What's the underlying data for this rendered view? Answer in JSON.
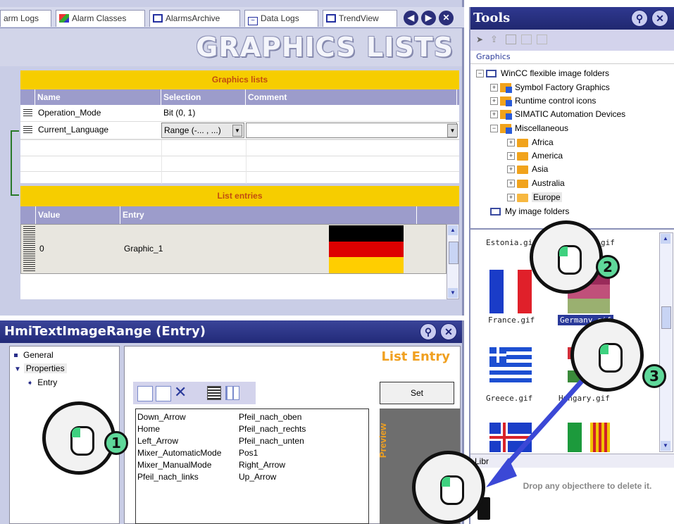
{
  "editor": {
    "tabs": [
      {
        "label": "arm Logs"
      },
      {
        "label": "Alarm Classes"
      },
      {
        "label": "AlarmsArchive"
      },
      {
        "label": "Data Logs"
      },
      {
        "label": "TrendView"
      }
    ],
    "banner_title": "GRAPHICS LISTS",
    "graphics_lists": {
      "section_title": "Graphics lists",
      "columns": [
        "Name",
        "Selection",
        "Comment"
      ],
      "rows": [
        {
          "name": "Operation_Mode",
          "selection": "Bit (0, 1)",
          "comment": ""
        },
        {
          "name": "Current_Language",
          "selection": "Range (-... , ...)",
          "comment": ""
        }
      ]
    },
    "list_entries": {
      "section_title": "List entries",
      "columns": [
        "Value",
        "Entry"
      ],
      "rows": [
        {
          "value": "0",
          "entry": "Graphic_1",
          "flag_colors": [
            "#000000",
            "#dd0000",
            "#ffce00"
          ]
        }
      ]
    }
  },
  "tools": {
    "title": "Tools",
    "graphics_label": "Graphics",
    "tree": [
      {
        "label": "WinCC flexible image folders",
        "level": 0,
        "expander": "-"
      },
      {
        "label": "Symbol Factory Graphics",
        "level": 1,
        "expander": "+"
      },
      {
        "label": "Runtime control icons",
        "level": 1,
        "expander": "+"
      },
      {
        "label": "SIMATIC Automation Devices",
        "level": 1,
        "expander": "+"
      },
      {
        "label": "Miscellaneous",
        "level": 1,
        "expander": "-"
      },
      {
        "label": "Africa",
        "level": 2,
        "expander": "+"
      },
      {
        "label": "America",
        "level": 2,
        "expander": "+"
      },
      {
        "label": "Asia",
        "level": 2,
        "expander": "+"
      },
      {
        "label": "Australia",
        "level": 2,
        "expander": "+"
      },
      {
        "label": "Europe",
        "level": 2,
        "expander": "+"
      },
      {
        "label": "My image folders",
        "level": 0,
        "expander": ""
      }
    ],
    "images": {
      "estonia": "Estonia.gif",
      "france": "France.gif",
      "germany": "Germany.gif",
      "greece": "Greece.gif",
      "hungary": "Hungary.gif",
      "gif_partial": "gif"
    },
    "library_label": "Libr",
    "drop_text": "Drop any objecthere to delete it."
  },
  "properties": {
    "title": "HmiTextImageRange (Entry)",
    "nav": [
      {
        "label": "General"
      },
      {
        "label": "Properties"
      },
      {
        "label": "Entry"
      }
    ],
    "panel_title": "List Entry",
    "set_label": "Set",
    "preview_label": "Preview",
    "graphics": [
      "Down_Arrow",
      "Home",
      "Left_Arrow",
      "Mixer_AutomaticMode",
      "Mixer_ManualMode",
      "Pfeil_nach_links",
      "Pfeil_nach_oben",
      "Pfeil_nach_rechts",
      "Pfeil_nach_unten",
      "Pos1",
      "Right_Arrow",
      "Up_Arrow"
    ]
  },
  "steps": [
    "1",
    "2",
    "3"
  ]
}
